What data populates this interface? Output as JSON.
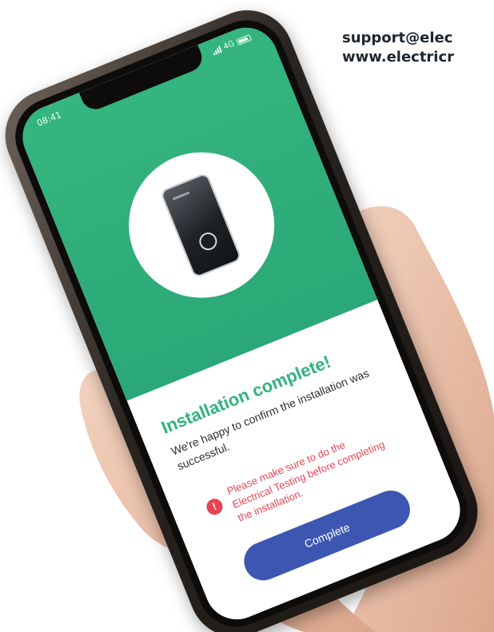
{
  "contact": {
    "email": "support@elec",
    "website": "www.electricr"
  },
  "status_bar": {
    "time": "08:41",
    "network": "4G"
  },
  "screen": {
    "title": "Installation complete!",
    "subtitle": "We're happy to confirm the installation was successful.",
    "alert_icon": "!",
    "alert_text": "Please make sure to do the Electrical Testing before completing the installation.",
    "complete_button": "Complete"
  },
  "colors": {
    "hero_green": "#2fb37c",
    "alert_red": "#e64553",
    "button_blue": "#3d56b2"
  },
  "icons": {
    "alert": "exclamation-circle-icon",
    "battery": "battery-icon",
    "signal": "signal-icon"
  }
}
